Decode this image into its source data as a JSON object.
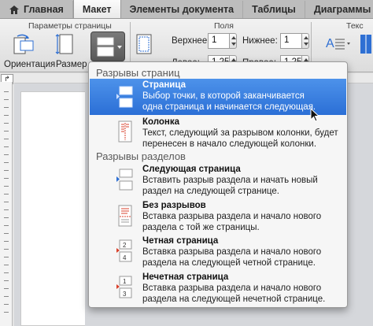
{
  "tabs": {
    "home": "Главная",
    "layout": "Макет",
    "doc_elements": "Элементы документа",
    "tables": "Таблицы",
    "charts": "Диаграммы"
  },
  "ribbon": {
    "page_setup_title": "Параметры страницы",
    "margins_title": "Поля",
    "text_title": "Текс",
    "orientation_label": "Ориентация",
    "size_label": "Размер",
    "top_label": "Верхнее:",
    "bottom_label": "Нижнее:",
    "left_label": "Левое:",
    "right_label": "Правое:",
    "top_value": "1",
    "bottom_value": "1",
    "left_value": "1,25",
    "right_value": "1,25"
  },
  "menu": {
    "page_breaks_header": "Разрывы страниц",
    "section_breaks_header": "Разрывы разделов",
    "items": [
      {
        "title": "Страница",
        "lines": [
          "Выбор точки, в которой заканчивается",
          "одна страница и начинается следующая."
        ],
        "icon": "page-break-icon",
        "selected": true
      },
      {
        "title": "Колонка",
        "lines": [
          "Текст, следующий за разрывом колонки, будет",
          "перенесен в начало следующей колонки."
        ],
        "icon": "column-break-icon",
        "selected": false
      },
      {
        "title": "Следующая страница",
        "lines": [
          "Вставить разрыв раздела и начать новый",
          "раздел на следующей странице."
        ],
        "icon": "next-page-section-icon",
        "selected": false
      },
      {
        "title": "Без разрывов",
        "lines": [
          "Вставка разрыва раздела и начало нового",
          "раздела с той же страницы."
        ],
        "icon": "continuous-section-icon",
        "selected": false
      },
      {
        "title": "Четная страница",
        "lines": [
          "Вставка разрыва раздела и начало нового",
          "раздела на следующей четной странице."
        ],
        "icon": "even-page-section-icon",
        "selected": false
      },
      {
        "title": "Нечетная страница",
        "lines": [
          "Вставка разрыва раздела и начало нового",
          "раздела на следующей нечетной странице."
        ],
        "icon": "odd-page-section-icon",
        "selected": false
      }
    ]
  },
  "colors": {
    "selection": "#2b6fd6",
    "accent_red": "#d9412c"
  }
}
